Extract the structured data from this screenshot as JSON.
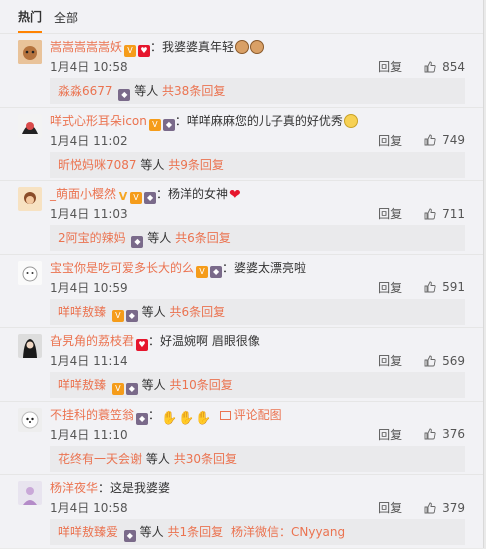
{
  "tabs": [
    "热门",
    "全部"
  ],
  "colors": {
    "name": "#eb7350",
    "accent": "#ff8200"
  },
  "comments": [
    {
      "user": "嵩嵩嵩嵩嵩妖",
      "text": "我婆婆真年轻",
      "date": "1月4日 10:58",
      "reply_label": "回复",
      "likes": "854",
      "sub": {
        "who": "淼淼6677",
        "mid": "等人",
        "total": "共38条回复"
      }
    },
    {
      "user": "咩式心形耳朵icon",
      "text": "咩咩麻麻您的儿子真的好优秀",
      "date": "1月4日 11:02",
      "reply_label": "回复",
      "likes": "749",
      "sub": {
        "who": "昕悦妈咪7087",
        "mid": "等人",
        "total": "共9条回复"
      }
    },
    {
      "user": "_萌面小樱然",
      "text": "杨洋的女神",
      "date": "1月4日 11:03",
      "reply_label": "回复",
      "likes": "711",
      "sub": {
        "who": "2阿宝的辣妈",
        "mid": "等人",
        "total": "共6条回复"
      }
    },
    {
      "user": "宝宝你是吃可爱多长大的么",
      "text": "婆婆太漂亮啦",
      "date": "1月4日 10:59",
      "reply_label": "回复",
      "likes": "591",
      "sub": {
        "who": "咩咩敖臻",
        "mid": "等人",
        "total": "共6条回复"
      }
    },
    {
      "user": "旮旯角的荔枝君",
      "text": "好温婉啊 眉眼很像",
      "date": "1月4日 11:14",
      "reply_label": "回复",
      "likes": "569",
      "sub": {
        "who": "咩咩敖臻",
        "mid": "等人",
        "total": "共10条回复"
      }
    },
    {
      "user": "不挂科的蓑笠翁",
      "text": "",
      "pic_link": "评论配图",
      "date": "1月4日 11:10",
      "reply_label": "回复",
      "likes": "376",
      "sub": {
        "who": "花终有一天会谢",
        "mid": "等人",
        "total": "共30条回复"
      }
    },
    {
      "user": "杨洋夜华",
      "text": "这是我婆婆",
      "date": "1月4日 10:58",
      "reply_label": "回复",
      "likes": "379",
      "sub": {
        "who": "咩咩敖臻爱",
        "mid": "等人",
        "total": "共1条回复",
        "extra": "杨洋微信：CNyyang"
      }
    }
  ]
}
